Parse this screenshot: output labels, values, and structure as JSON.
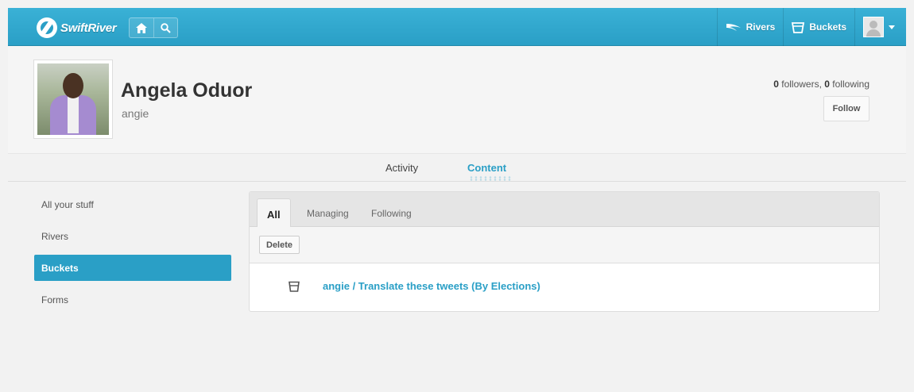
{
  "nav": {
    "logo_text": "SwiftRiver",
    "home_icon": "home-icon",
    "search_icon": "search-icon",
    "rivers_label": "Rivers",
    "buckets_label": "Buckets",
    "rivers_icon": "river-icon",
    "buckets_icon": "bucket-icon",
    "user_icon": "avatar"
  },
  "profile": {
    "name": "Angela Oduor",
    "username": "angie",
    "followers_count": "0",
    "followers_label": " followers, ",
    "following_count": "0",
    "following_label": " following",
    "follow_button": "Follow"
  },
  "tabs": [
    {
      "label": "Activity",
      "active": false
    },
    {
      "label": "Content",
      "active": true
    }
  ],
  "sidebar": {
    "items": [
      {
        "label": "All your stuff",
        "active": false
      },
      {
        "label": "Rivers",
        "active": false
      },
      {
        "label": "Buckets",
        "active": true
      },
      {
        "label": "Forms",
        "active": false
      }
    ]
  },
  "panel": {
    "tabs": [
      {
        "label": "All",
        "active": true
      },
      {
        "label": "Managing",
        "active": false
      },
      {
        "label": "Following",
        "active": false
      }
    ],
    "delete_button": "Delete",
    "rows": [
      {
        "icon": "bucket-icon",
        "title": "angie / Translate these tweets (By Elections)"
      }
    ]
  },
  "colors": {
    "accent": "#2a9fc6",
    "topbar": "#3ab1d6",
    "background": "#f2f2f2"
  }
}
